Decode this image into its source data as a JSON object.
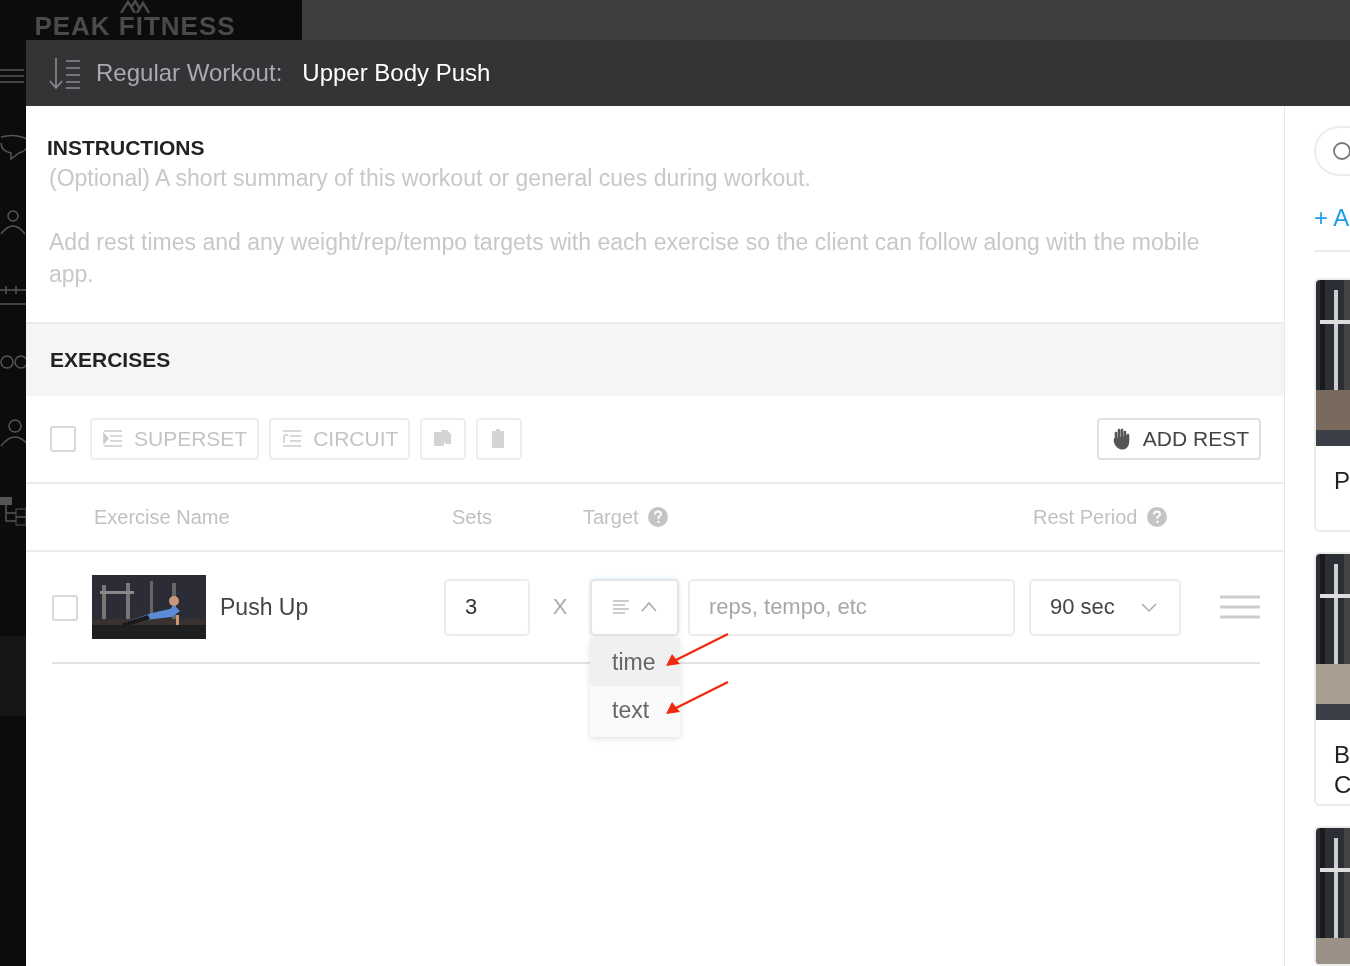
{
  "app": {
    "logo": "PEAK FITNESS"
  },
  "modal": {
    "label": "Regular Workout:",
    "title": "Upper Body Push"
  },
  "instructions": {
    "heading": "INSTRUCTIONS",
    "placeholder": "(Optional) A short summary of this workout or general cues during workout.\n\nAdd rest times and any weight/rep/tempo targets with each exercise so the client can follow along with the mobile app."
  },
  "exercises": {
    "heading": "EXERCISES",
    "select_all": {
      "checked": false
    },
    "toolbar": [
      {
        "kind": "superset",
        "label": "SUPERSET"
      },
      {
        "kind": "circuit",
        "label": "CIRCUIT"
      },
      {
        "kind": "copy"
      },
      {
        "kind": "delete"
      }
    ],
    "add_rest": "ADD REST",
    "columns": [
      {
        "label": "Exercise Name",
        "help": false
      },
      {
        "label": "Sets",
        "help": false
      },
      {
        "label": "Target",
        "help": true
      },
      {
        "label": "Rest Period",
        "help": true
      }
    ],
    "rows": [
      {
        "checked": false,
        "thumbnail": {
          "kind": "picture"
        },
        "name": "Push Up",
        "sets": "3",
        "times": "X",
        "target_type": {
          "expanded": true,
          "options": [
            {
              "label": "time",
              "selected": true,
              "marked": true
            },
            {
              "label": "text",
              "selected": false,
              "marked": true
            }
          ]
        },
        "target": {
          "placeholder": "reps, tempo, etc"
        },
        "rest": "90 sec"
      }
    ]
  },
  "library": {
    "add_link": "+ A",
    "cards": [
      {
        "image": {
          "kind": "picture"
        },
        "title": [
          "P"
        ]
      },
      {
        "image": {
          "kind": "picture"
        },
        "title": [
          "B",
          "C"
        ]
      },
      {
        "image": {
          "kind": "picture"
        }
      }
    ]
  }
}
